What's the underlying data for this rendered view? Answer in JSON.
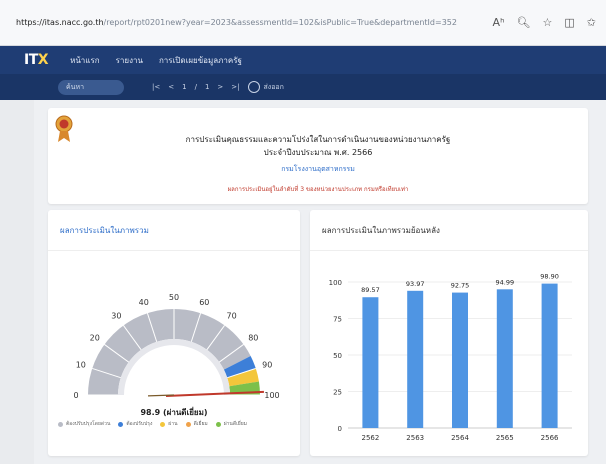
{
  "browser": {
    "url_host": "https://itas.nacc.go.th",
    "url_path": "/report/rpt0201new?year=2023&assessmentId=102&isPublic=True&departmentId=352",
    "reader_label": "Aʰ"
  },
  "nav": {
    "logo_a": "IT",
    "logo_b": "X",
    "items": [
      "หน้าแรก",
      "รายงาน",
      "การเปิดเผยข้อมูลภาครัฐ"
    ]
  },
  "toolbar": {
    "search_label": "ค้นหา",
    "page_controls": [
      "|<",
      "<",
      "1",
      "/",
      "1",
      ">",
      ">|"
    ],
    "share_label": "ส่งออก"
  },
  "header": {
    "title_line1": "การประเมินคุณธรรมและความโปร่งใสในการดำเนินงานของหน่วยงานภาครัฐ",
    "title_line2": "ประจำปีงบประมาณ พ.ศ. 2566",
    "department": "กรมโรงงานอุตสาหกรรม",
    "note": "ผลการประเมินอยู่ในลำดับที่ 3 ของหน่วยงานประเภท กรมหรือเทียบเท่า"
  },
  "left_card": {
    "title": "ผลการประเมินในภาพรวม",
    "score_label": "98.9 (ผ่านดีเยี่ยม)",
    "legend": [
      {
        "label": "ต้องปรับปรุงโดยด่วน",
        "color": "#b9bcc6"
      },
      {
        "label": "ต้องปรับปรุง",
        "color": "#3d7fd8"
      },
      {
        "label": "ผ่าน",
        "color": "#f3c63b"
      },
      {
        "label": "ดีเยี่ยม",
        "color": "#f0a24a"
      },
      {
        "label": "ผ่านดีเยี่ยม",
        "color": "#7cc04a"
      }
    ]
  },
  "right_card": {
    "title": "ผลการประเมินในภาพรวมย้อนหลัง"
  },
  "chart_data": [
    {
      "type": "gauge",
      "value": 98.9,
      "ylim": [
        0,
        100
      ],
      "ticks": [
        0,
        10,
        20,
        30,
        40,
        50,
        60,
        70,
        80,
        90,
        100
      ],
      "bands": [
        {
          "from": 0,
          "to": 50,
          "color": "#b9bcc6"
        },
        {
          "from": 50,
          "to": 85,
          "color": "#b9bcc6"
        },
        {
          "from": 85,
          "to": 90,
          "color": "#3d7fd8"
        },
        {
          "from": 90,
          "to": 95,
          "color": "#f3c63b"
        },
        {
          "from": 95,
          "to": 100,
          "color": "#7cc04a"
        }
      ]
    },
    {
      "type": "bar",
      "categories": [
        "2562",
        "2563",
        "2564",
        "2565",
        "2566"
      ],
      "values": [
        89.57,
        93.97,
        92.75,
        94.99,
        98.9
      ],
      "value_labels": [
        "89.57",
        "93.97",
        "92.75",
        "94.99",
        "98.90"
      ],
      "yticks": [
        0,
        25,
        50,
        75,
        100
      ],
      "ylim": [
        0,
        100
      ],
      "bar_color": "#4f95e3"
    }
  ]
}
